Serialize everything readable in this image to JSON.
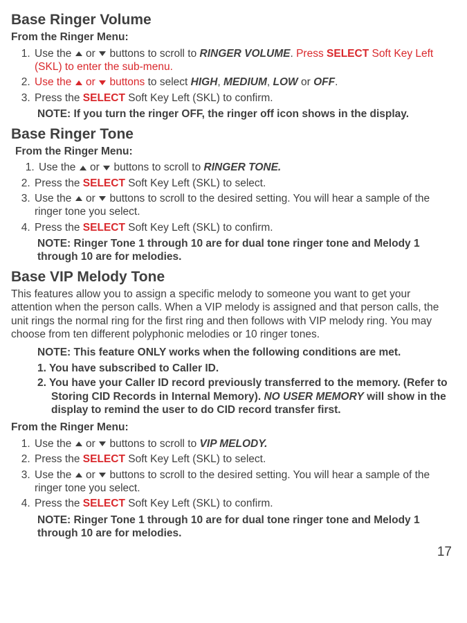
{
  "s1": {
    "title": "Base Ringer Volume",
    "sub": "From the Ringer Menu:",
    "i1a": "Use the ",
    "i1b": " or ",
    "i1c": " buttons to scroll to ",
    "i1d": "RINGER VOLUME",
    "i1e": ". ",
    "i1f": "Press ",
    "i1g": "SELECT",
    "i1h": " Soft Key Left (SKL) to enter the sub-menu.",
    "i2a": "Use the ",
    "i2b": " or ",
    "i2c": " buttons",
    "i2d": " to select ",
    "i2e": "HIGH",
    "i2f": ", ",
    "i2g": "MEDIUM",
    "i2h": ", ",
    "i2i": "LOW",
    "i2j": " or ",
    "i2k": "OFF",
    "i2l": ".",
    "i3a": "Press the ",
    "i3b": "SELECT",
    "i3c": " Soft Key Left (SKL) to confirm.",
    "note": "NOTE: If you turn the ringer OFF, the ringer off icon shows in the display."
  },
  "s2": {
    "title": "Base Ringer Tone",
    "sub": "From the Ringer Menu:",
    "i1a": "Use the ",
    "i1b": " or ",
    "i1c": " buttons to scroll to ",
    "i1d": "RINGER TONE.",
    "i2a": "Press the ",
    "i2b": "SELECT",
    "i2c": " Soft Key Left (SKL) to select.",
    "i3a": "Use the ",
    "i3b": " or ",
    "i3c": " buttons to scroll to the desired setting. You will hear a sample of the ringer tone you select.",
    "i4a": "Press the ",
    "i4b": "SELECT",
    "i4c": " Soft Key Left (SKL) to confirm.",
    "note": "NOTE: Ringer Tone 1 through 10 are for dual tone ringer tone and Melody 1 through 10 are for melodies."
  },
  "s3": {
    "title": "Base VIP Melody Tone",
    "para": "This features allow you to assign a specific melody to someone you want to get your attention when the person calls. When a VIP melody is assigned and that person calls, the unit rings the normal ring for the first ring and then follows with VIP melody ring. You may choose from ten different polyphonic melodies or 10 ringer tones.",
    "n0": "NOTE: This feature ONLY works when the following conditions are met.",
    "n1": "1. You have subscribed to Caller ID.",
    "n2a": "2.",
    "n2b": " You have your Caller ID record previously transferred to the memory. (Refer to Storing CID Records in Internal Memory). ",
    "n2c": "NO USER MEMORY",
    "n2d": " will show in the display to remind the user to do CID record transfer first.",
    "sub": "From the Ringer Menu:",
    "i1a": "Use the ",
    "i1b": " or ",
    "i1c": " buttons to scroll to ",
    "i1d": "VIP MELODY.",
    "i2a": "Press the ",
    "i2b": "SELECT",
    "i2c": " Soft Key Left (SKL) to select.",
    "i3a": "Use the ",
    "i3b": " or ",
    "i3c": " buttons to scroll to the desired setting. You will hear a sample of the ringer tone you select.",
    "i4a": "Press the ",
    "i4b": "SELECT",
    "i4c": " Soft Key Left (SKL) to confirm.",
    "note": "NOTE: Ringer Tone 1 through 10 are for dual tone ringer tone and Melody 1 through 10 are for melodies."
  },
  "pagenum": "17"
}
